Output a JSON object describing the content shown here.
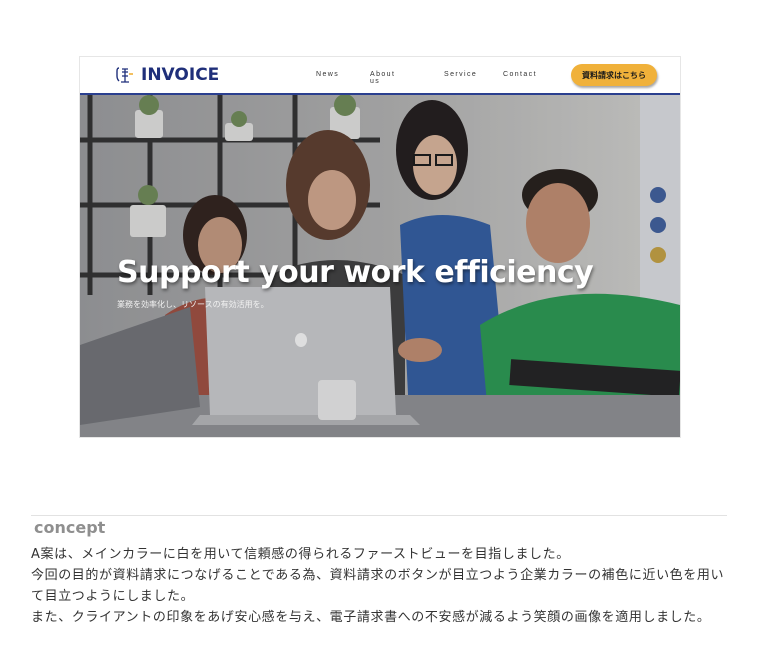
{
  "mockup": {
    "logo_text": "INVOICE",
    "nav": {
      "news": "News",
      "about": "About us",
      "service": "Service",
      "contact": "Contact"
    },
    "cta_label": "資料請求はこちら",
    "hero_title": "Support your work efficiency",
    "hero_subtitle": "業務を効率化し、リソースの有効活用を。",
    "colors": {
      "brand": "#1f2f7a",
      "cta": "#f0b13a"
    }
  },
  "concept": {
    "heading": "concept",
    "paragraphs": [
      "A案は、メインカラーに白を用いて信頼感の得られるファーストビューを目指しました。",
      "今回の目的が資料請求につなげることである為、資料請求のボタンが目立つよう企業カラーの補色に近い色を用いて目立つようにしました。",
      "また、クライアントの印象をあげ安心感を与え、電子請求書への不安感が減るよう笑顔の画像を適用しました。"
    ]
  }
}
